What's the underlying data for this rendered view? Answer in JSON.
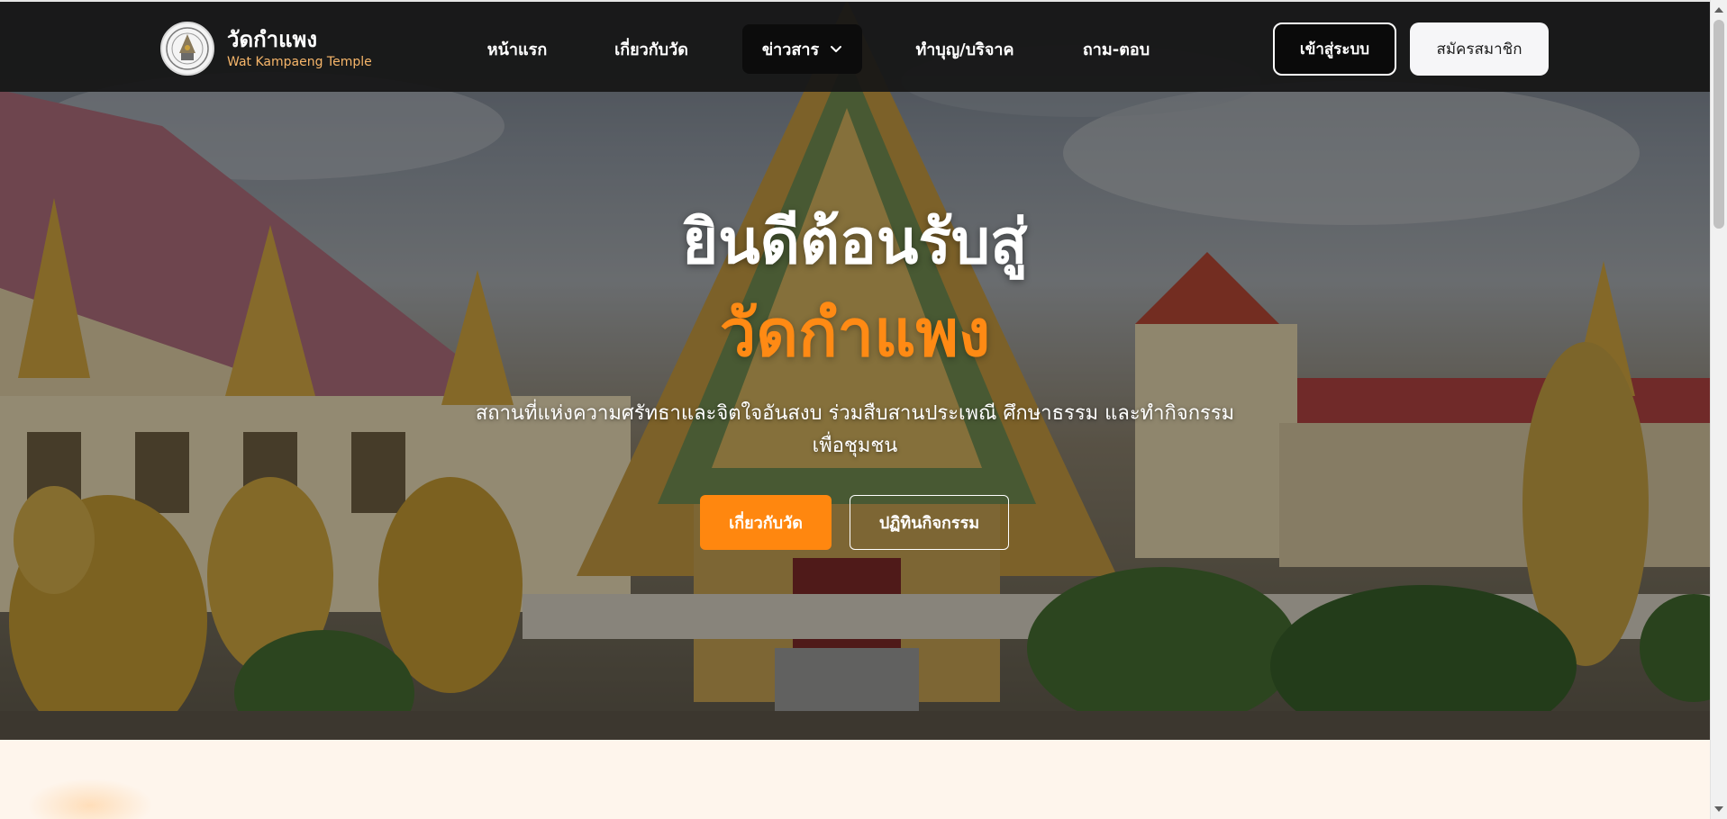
{
  "brand": {
    "name": "วัดกำแพง",
    "subtitle": "Wat Kampaeng Temple",
    "logo_icon": "temple-seal-icon"
  },
  "nav": {
    "items": [
      {
        "label": "หน้าแรก"
      },
      {
        "label": "เกี่ยวกับวัด"
      },
      {
        "label": "ข่าวสาร",
        "active": true,
        "icon": "chevron-down-icon"
      },
      {
        "label": "ทำบุญ/บริจาค"
      },
      {
        "label": "ถาม-ตอบ"
      }
    ],
    "login_label": "เข้าสู่ระบบ",
    "register_label": "สมัครสมาชิก"
  },
  "hero": {
    "title_line1": "ยินดีต้อนรับสู่",
    "title_line2": "วัดกำแพง",
    "description": "สถานที่แห่งความศรัทธาและจิตใจอันสงบ ร่วมสืบสานประเพณี ศึกษาธรรม และทำกิจกรรมเพื่อชุมชน",
    "primary_button": "เกี่ยวกับวัด",
    "secondary_button": "ปฏิทินกิจกรรม"
  },
  "colors": {
    "accent": "#ff870f",
    "navbar_bg": "#161616",
    "brand_sub": "#f7b66a",
    "section_bg": "#fef5ec"
  }
}
